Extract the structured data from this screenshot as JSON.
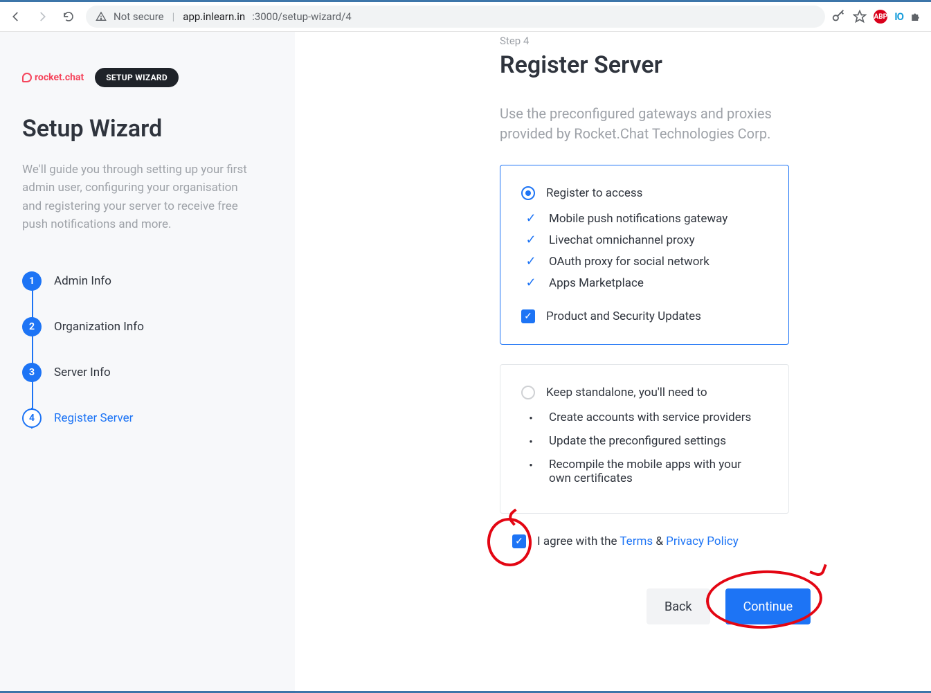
{
  "browser": {
    "not_secure": "Not secure",
    "host": "app.inlearn.in",
    "path": ":3000/setup-wizard/4",
    "icons": {
      "abp": "ABP",
      "io": "IO"
    }
  },
  "sidebar": {
    "brand": "rocket.chat",
    "badge": "SETUP WIZARD",
    "title": "Setup Wizard",
    "desc": "We'll guide you through setting up your first admin user, configuring your organisation and registering your server to receive free push notifications and more.",
    "steps": [
      {
        "num": "1",
        "label": "Admin Info"
      },
      {
        "num": "2",
        "label": "Organization Info"
      },
      {
        "num": "3",
        "label": "Server Info"
      },
      {
        "num": "4",
        "label": "Register Server"
      }
    ]
  },
  "content": {
    "step_label": "Step 4",
    "title": "Register Server",
    "desc": "Use the preconfigured gateways and proxies provided by Rocket.Chat Technologies Corp.",
    "register": {
      "title": "Register to access",
      "items": [
        "Mobile push notifications gateway",
        "Livechat omnichannel proxy",
        "OAuth proxy for social network",
        "Apps Marketplace"
      ],
      "checkbox": "Product and Security Updates"
    },
    "standalone": {
      "title": "Keep standalone, you'll need to",
      "items": [
        "Create accounts with service providers",
        "Update the preconfigured settings",
        "Recompile the mobile apps with your own certificates"
      ]
    },
    "agree": {
      "prefix": "I agree with the ",
      "terms": "Terms",
      "amp": " & ",
      "privacy": "Privacy Policy"
    },
    "buttons": {
      "back": "Back",
      "continue": "Continue"
    }
  }
}
